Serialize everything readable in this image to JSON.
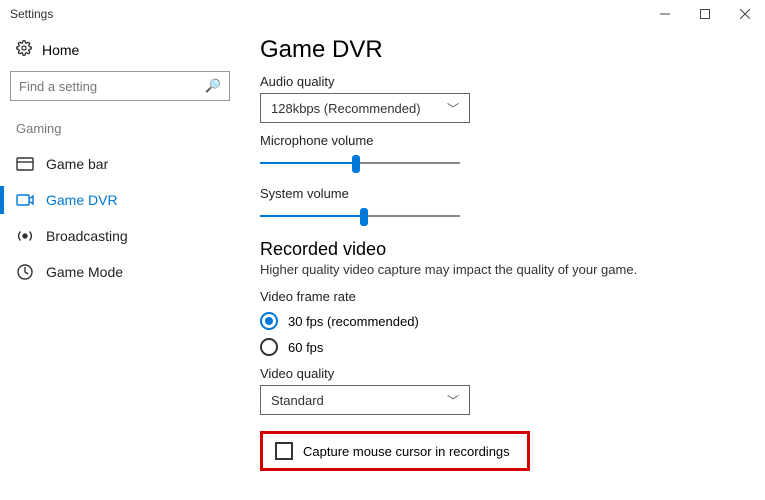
{
  "window": {
    "title": "Settings"
  },
  "sidebar": {
    "home": "Home",
    "search_placeholder": "Find a setting",
    "category": "Gaming",
    "items": [
      {
        "label": "Game bar"
      },
      {
        "label": "Game DVR"
      },
      {
        "label": "Broadcasting"
      },
      {
        "label": "Game Mode"
      }
    ]
  },
  "page": {
    "title": "Game DVR",
    "audio_quality_label": "Audio quality",
    "audio_quality_value": "128kbps (Recommended)",
    "mic_volume_label": "Microphone volume",
    "mic_volume_percent": 48,
    "sys_volume_label": "System volume",
    "sys_volume_percent": 52,
    "recorded_video_title": "Recorded video",
    "recorded_video_desc": "Higher quality video capture may impact the quality of your game.",
    "frame_rate_label": "Video frame rate",
    "frame_rate_options": [
      {
        "label": "30 fps (recommended)",
        "checked": true
      },
      {
        "label": "60 fps",
        "checked": false
      }
    ],
    "video_quality_label": "Video quality",
    "video_quality_value": "Standard",
    "capture_cursor_label": "Capture mouse cursor in recordings",
    "capture_cursor_checked": false
  }
}
